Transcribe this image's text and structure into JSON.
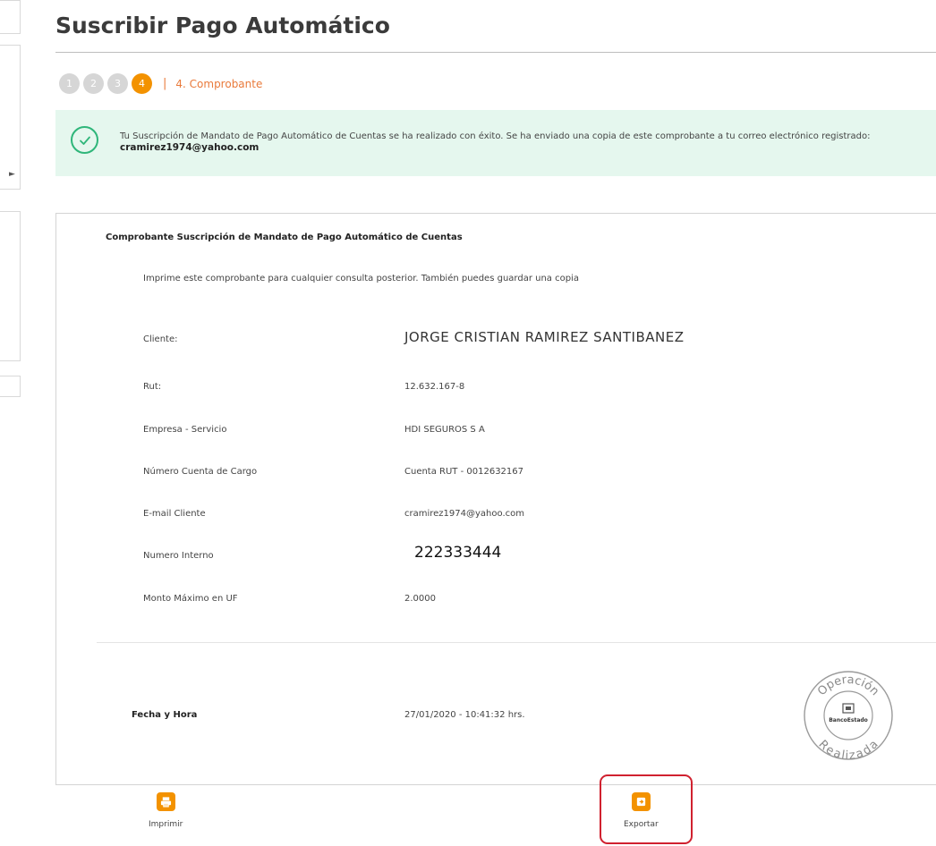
{
  "page": {
    "title": "Suscribir Pago Automático"
  },
  "stepper": {
    "steps": [
      "1",
      "2",
      "3",
      "4"
    ],
    "active_step": 4,
    "current_label": "4. Comprobante"
  },
  "alert": {
    "message": "Tu Suscripción de Mandato de Pago Automático de Cuentas se ha realizado con éxito. Se ha enviado una copia de este comprobante a tu correo electrónico registrado:",
    "email": "cramirez1974@yahoo.com",
    "color": "#e5f7ee"
  },
  "receipt": {
    "title": "Comprobante Suscripción de Mandato de Pago Automático de Cuentas",
    "subtitle": "Imprime este comprobante para cualquier consulta posterior. También puedes guardar una copia",
    "rows": [
      {
        "label": "Cliente:",
        "value": "JORGE CRISTIAN RAMIREZ SANTIBANEZ"
      },
      {
        "label": "Rut:",
        "value": "12.632.167-8"
      },
      {
        "label": "Empresa - Servicio",
        "value": "HDI SEGUROS S A"
      },
      {
        "label": "Número Cuenta de Cargo",
        "value": "Cuenta RUT  -  0012632167"
      },
      {
        "label": "E-mail Cliente",
        "value": "cramirez1974@yahoo.com"
      },
      {
        "label": "Numero Interno",
        "value": "222333444"
      },
      {
        "label": "Monto Máximo en UF",
        "value": "2.0000"
      }
    ],
    "datetime_label": "Fecha y Hora",
    "datetime_value": "27/01/2020 - 10:41:32 hrs.",
    "seal": {
      "top": "Operación",
      "bottom": "Realizada",
      "brand": "BancoEstado"
    }
  },
  "actions": {
    "print_label": "Imprimir",
    "export_label": "Exportar"
  },
  "colors": {
    "accent": "#f39200",
    "success": "#2fb67a",
    "highlight": "#d0212f"
  },
  "icons": [
    "check-circle-icon",
    "print-icon",
    "export-icon"
  ]
}
